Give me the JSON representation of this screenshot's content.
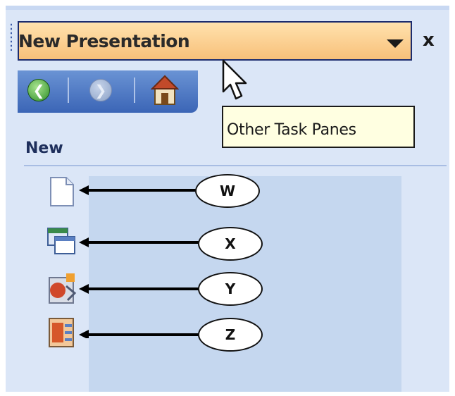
{
  "task_pane": {
    "title": "New Presentation",
    "dropdown_icon": "down-triangle-icon",
    "close_label": "x"
  },
  "nav": {
    "back_icon": "back-arrow-icon",
    "forward_icon": "forward-arrow-icon",
    "home_icon": "home-icon"
  },
  "tooltip": {
    "text": "Other Task Panes"
  },
  "section": {
    "heading": "New"
  },
  "items": [
    {
      "icon": "blank-document-icon",
      "callout": "W"
    },
    {
      "icon": "design-template-icon",
      "callout": "X"
    },
    {
      "icon": "autocontent-wizard-icon",
      "callout": "Y"
    },
    {
      "icon": "existing-presentation-icon",
      "callout": "Z"
    }
  ],
  "colors": {
    "pane_background": "#dbe6f7",
    "title_bar": "#f8c07a",
    "nav_bar": "#3b65b6",
    "list_background": "#c5d7ef",
    "tooltip_background": "#ffffe1"
  }
}
